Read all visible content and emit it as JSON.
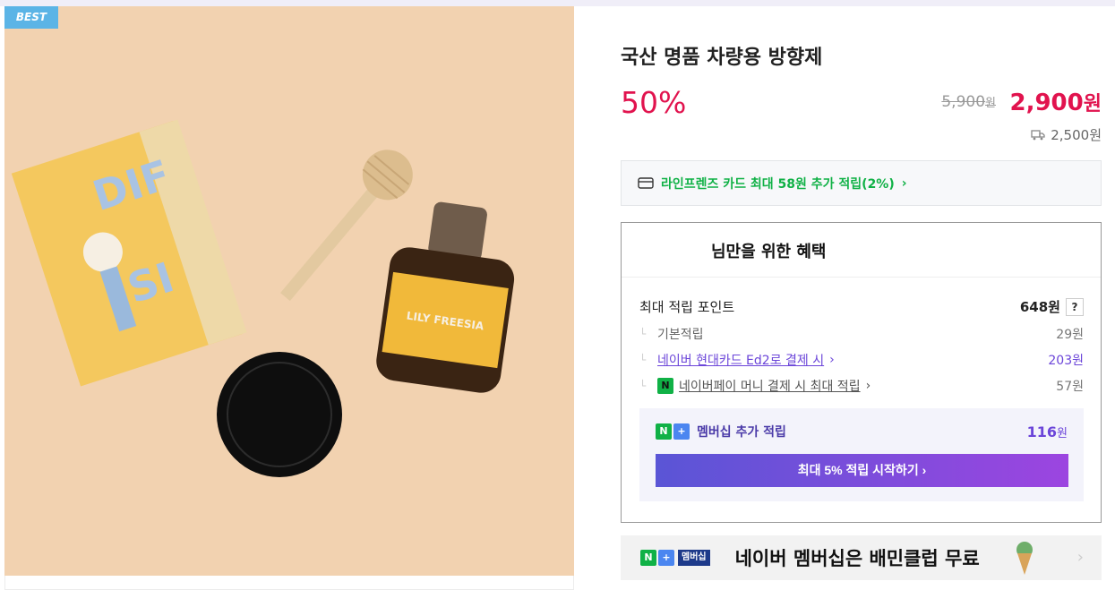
{
  "badge": "BEST",
  "product": {
    "title": "국산 명품 차량용 방향제",
    "discount": "50%",
    "original_price": "5,900",
    "original_unit": "원",
    "price": "2,900",
    "price_unit": "원",
    "shipping_fee": "2,500원",
    "bottle_label": "LILY FREESIA"
  },
  "card_promo": {
    "text": "라인프렌즈 카드 최대 58원 추가 적립(2%)",
    "chevron": "›"
  },
  "benefits": {
    "heading": "님만을 위한 혜택",
    "max_points_label": "최대 적립 포인트",
    "max_points_value": "648원",
    "help": "?",
    "basic_label": "기본적립",
    "basic_value": "29원",
    "card_label": "네이버 현대카드 Ed2로 결제 시",
    "card_value": "203원",
    "npay_label": "네이버페이 머니 결제 시 최대 적립",
    "npay_value": "57원",
    "membership_label": "멤버십 추가 적립",
    "membership_value": "116",
    "membership_unit": "원",
    "cta": "최대 5% 적립 시작하기 ›"
  },
  "banner": {
    "tag_label": "멤버십",
    "text": "네이버 멤버십은 배민클럽 무료",
    "chevron": "›"
  },
  "colors": {
    "accent_red": "#e1134e",
    "naver_green": "#10b146",
    "purple": "#6b45d9"
  }
}
